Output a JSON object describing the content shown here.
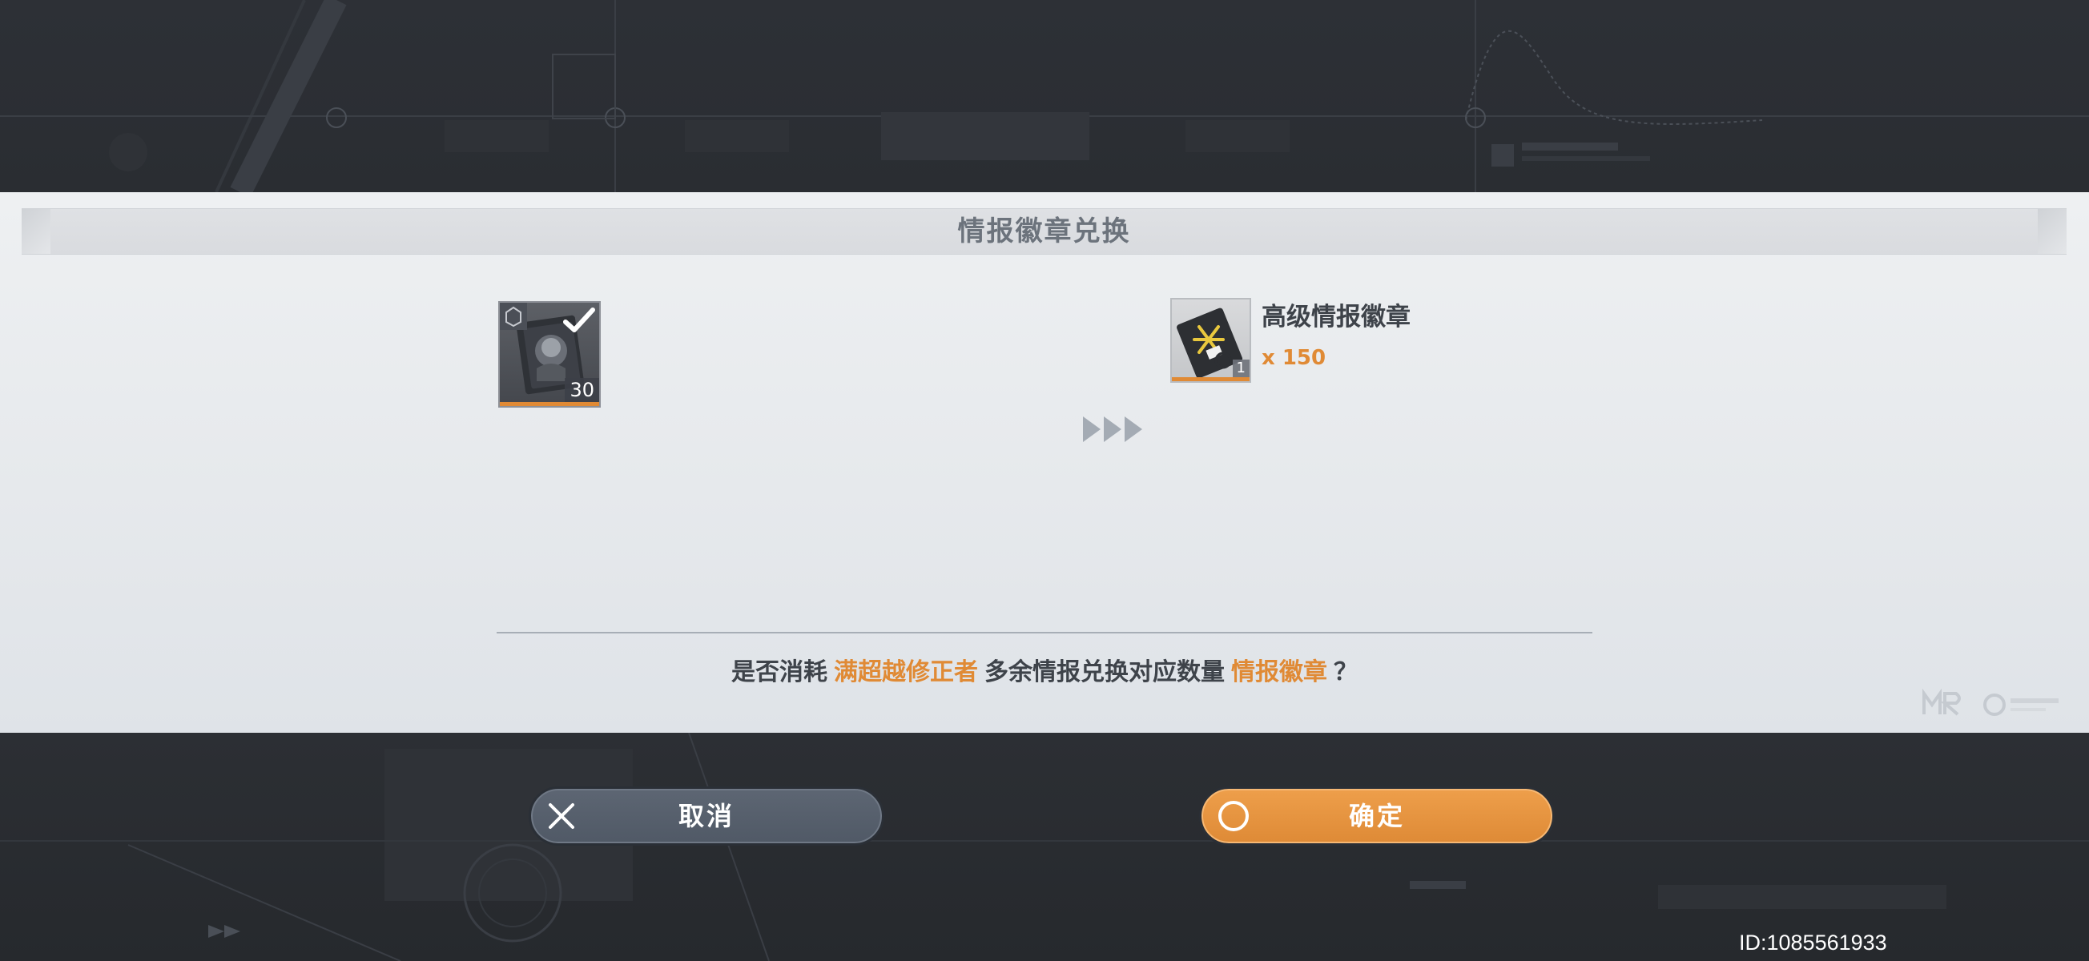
{
  "dialog": {
    "title": "情报徽章兑换"
  },
  "source_item": {
    "icon": "intel-item-icon",
    "count": "30",
    "selected": true
  },
  "reward_item": {
    "icon": "advanced-intel-badge-icon",
    "name": "高级情报徽章",
    "quantity": "x 150",
    "tier_badge": "1"
  },
  "question": {
    "part1": "是否消耗",
    "highlight1": "满超越修正者",
    "part2": "多余情报兑换对应数量",
    "highlight2": "情报徽章",
    "part3": "？"
  },
  "buttons": {
    "cancel": "取消",
    "confirm": "确定"
  },
  "player_id": "ID:1085561933",
  "colors": {
    "accent": "#e08a35",
    "text": "#3e434a",
    "cancel_button": "#57606c",
    "confirm_button": "#e8963f"
  }
}
